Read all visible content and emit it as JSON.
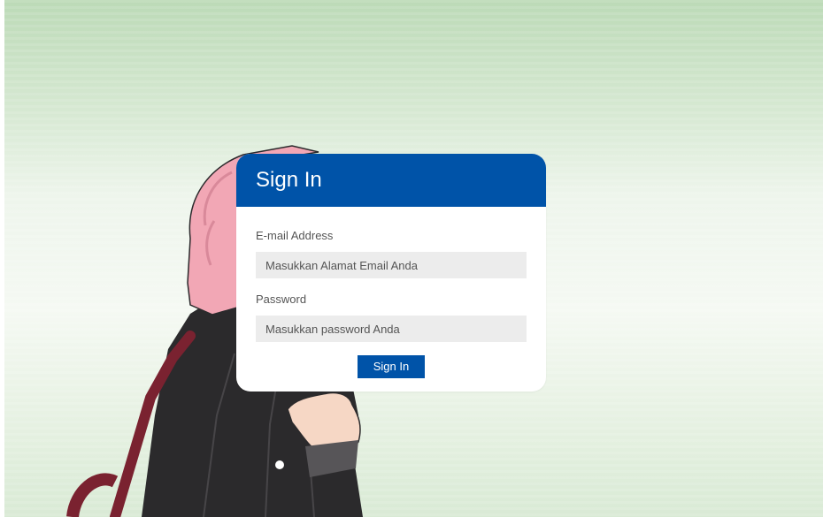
{
  "login": {
    "title": "Sign In",
    "email": {
      "label": "E-mail Address",
      "placeholder": "Masukkan Alamat Email Anda",
      "value": ""
    },
    "password": {
      "label": "Password",
      "placeholder": "Masukkan password Anda",
      "value": ""
    },
    "submit_label": "Sign In"
  },
  "colors": {
    "accent": "#0053a8",
    "input_bg": "#ececec",
    "background_top": "#bcdab7",
    "background_mid": "#f5f9f3"
  }
}
